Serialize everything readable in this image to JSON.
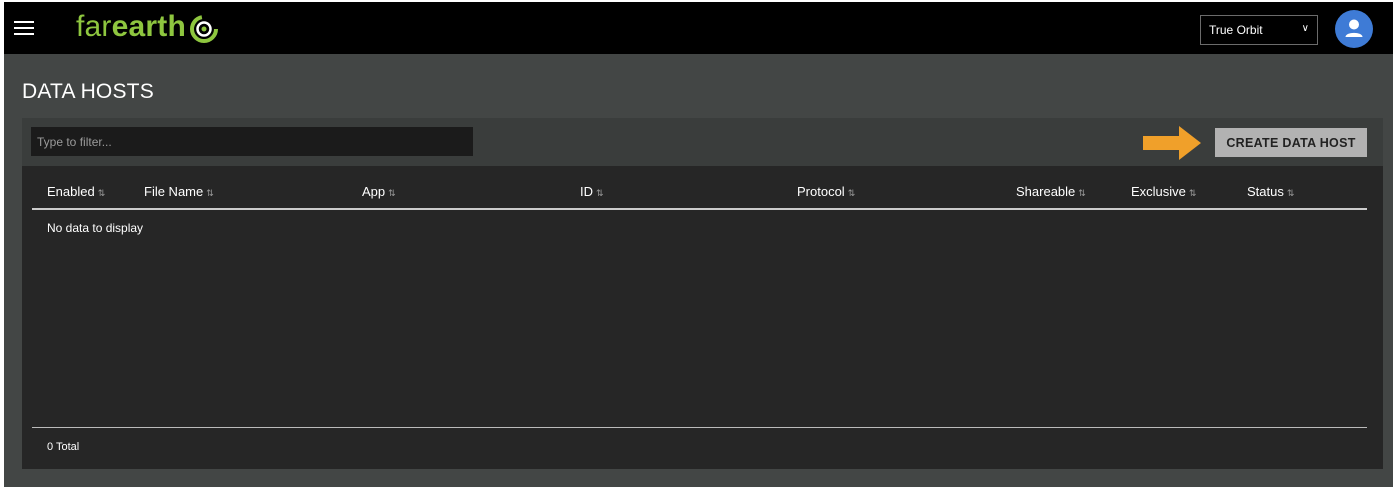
{
  "header": {
    "logo_part1": "far",
    "logo_part2": "earth",
    "org_select": {
      "selected": "True Orbit"
    },
    "colors": {
      "brand": "#8ec63f",
      "avatar": "#3e7bd6"
    }
  },
  "page": {
    "title": "DATA HOSTS"
  },
  "toolbar": {
    "filter_placeholder": "Type to filter...",
    "create_label": "CREATE DATA HOST",
    "arrow_color": "#f0a02a"
  },
  "table": {
    "columns": [
      "Enabled",
      "File Name",
      "App",
      "ID",
      "Protocol",
      "Shareable",
      "Exclusive",
      "Status"
    ],
    "empty_message": "No data to display",
    "total": "0 Total"
  },
  "icons": {
    "menu": "hamburger-icon",
    "account": "user-avatar-icon",
    "sort": "sort-icon",
    "dropdown": "chevron-down-icon",
    "callout": "arrow-right-icon"
  }
}
